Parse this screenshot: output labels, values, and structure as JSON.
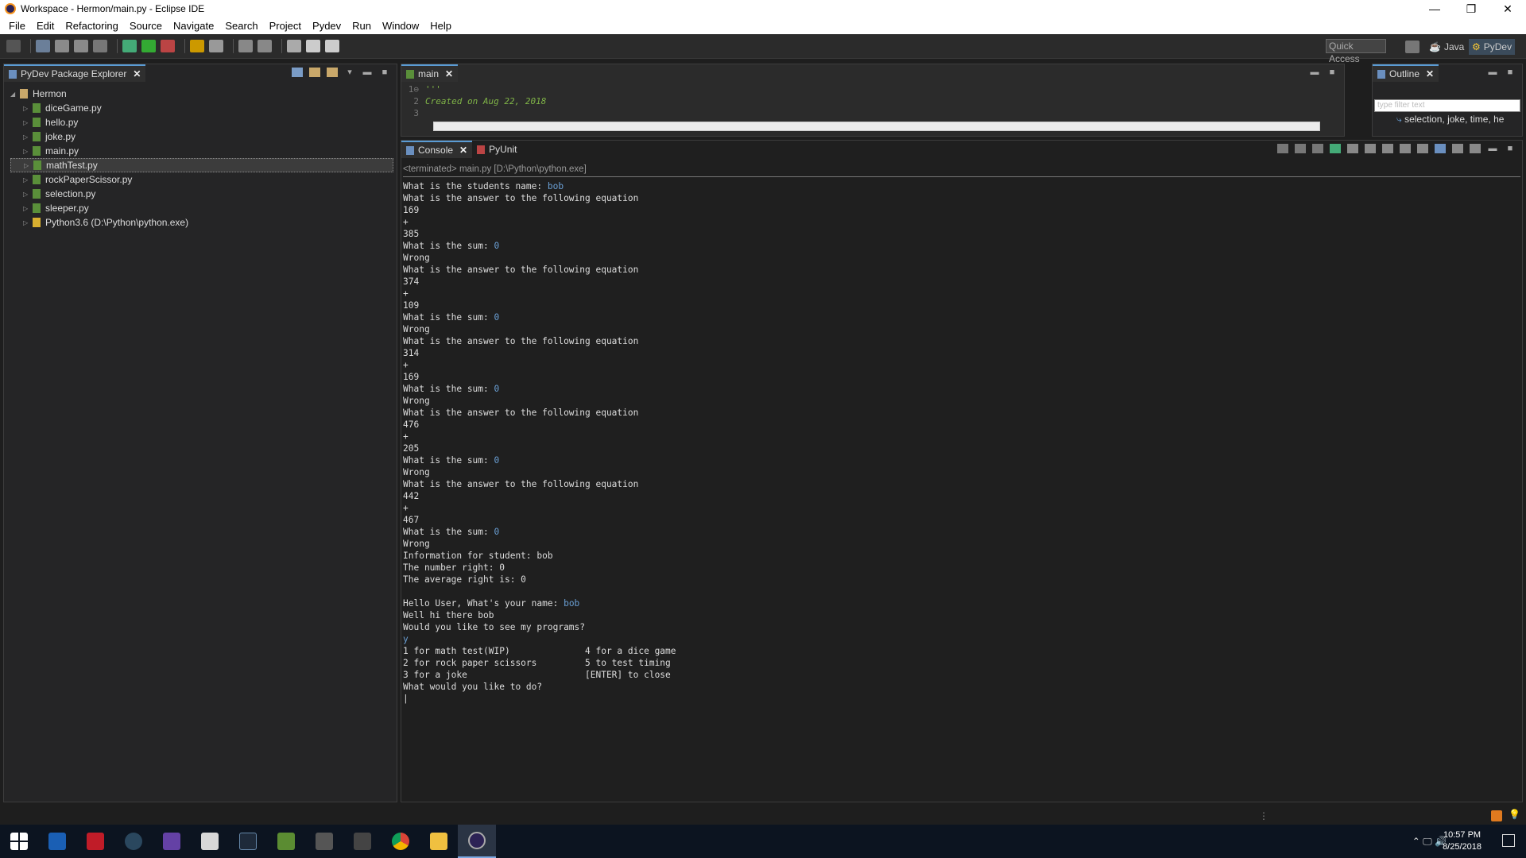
{
  "window": {
    "title": "Workspace - Hermon/main.py - Eclipse IDE",
    "controls": [
      "—",
      "❐",
      "✕"
    ]
  },
  "menu": [
    "File",
    "Edit",
    "Refactoring",
    "Source",
    "Navigate",
    "Search",
    "Project",
    "Pydev",
    "Run",
    "Window",
    "Help"
  ],
  "quick_access": "Quick Access",
  "perspectives": {
    "java": "Java",
    "pydev": "PyDev"
  },
  "explorer": {
    "tab_label": "PyDev Package Explorer",
    "project": "Hermon",
    "items": [
      {
        "label": "diceGame.py",
        "selected": false
      },
      {
        "label": "hello.py",
        "selected": false
      },
      {
        "label": "joke.py",
        "selected": false
      },
      {
        "label": "main.py",
        "selected": false
      },
      {
        "label": "mathTest.py",
        "selected": true
      },
      {
        "label": "rockPaperScissor.py",
        "selected": false
      },
      {
        "label": "selection.py",
        "selected": false
      },
      {
        "label": "sleeper.py",
        "selected": false
      },
      {
        "label": "Python3.6  (D:\\Python\\python.exe)",
        "selected": false
      }
    ]
  },
  "editor": {
    "tab_label": "main",
    "lines": [
      {
        "num": "1⊖",
        "text": "'''"
      },
      {
        "num": "2",
        "text": "Created on Aug 22, 2018"
      },
      {
        "num": "3",
        "text": ""
      }
    ]
  },
  "outline": {
    "tab_label": "Outline",
    "filter_placeholder": "type filter text",
    "item": "selection, joke, time, he"
  },
  "console": {
    "tab_label": "Console",
    "tab2_label": "PyUnit",
    "terminated": "<terminated> main.py [D:\\Python\\python.exe]",
    "lines": [
      {
        "text": "What is the students name: ",
        "input": "bob"
      },
      {
        "text": "What is the answer to the following equation",
        "input": ""
      },
      {
        "text": "169",
        "input": ""
      },
      {
        "text": "+",
        "input": ""
      },
      {
        "text": "385",
        "input": ""
      },
      {
        "text": "What is the sum: ",
        "input": "0"
      },
      {
        "text": "Wrong",
        "input": ""
      },
      {
        "text": "What is the answer to the following equation",
        "input": ""
      },
      {
        "text": "374",
        "input": ""
      },
      {
        "text": "+",
        "input": ""
      },
      {
        "text": "109",
        "input": ""
      },
      {
        "text": "What is the sum: ",
        "input": "0"
      },
      {
        "text": "Wrong",
        "input": ""
      },
      {
        "text": "What is the answer to the following equation",
        "input": ""
      },
      {
        "text": "314",
        "input": ""
      },
      {
        "text": "+",
        "input": ""
      },
      {
        "text": "169",
        "input": ""
      },
      {
        "text": "What is the sum: ",
        "input": "0"
      },
      {
        "text": "Wrong",
        "input": ""
      },
      {
        "text": "What is the answer to the following equation",
        "input": ""
      },
      {
        "text": "476",
        "input": ""
      },
      {
        "text": "+",
        "input": ""
      },
      {
        "text": "205",
        "input": ""
      },
      {
        "text": "What is the sum: ",
        "input": "0"
      },
      {
        "text": "Wrong",
        "input": ""
      },
      {
        "text": "What is the answer to the following equation",
        "input": ""
      },
      {
        "text": "442",
        "input": ""
      },
      {
        "text": "+",
        "input": ""
      },
      {
        "text": "467",
        "input": ""
      },
      {
        "text": "What is the sum: ",
        "input": "0"
      },
      {
        "text": "Wrong",
        "input": ""
      },
      {
        "text": "Information for student: bob",
        "input": ""
      },
      {
        "text": "The number right: 0",
        "input": ""
      },
      {
        "text": "The average right is: 0",
        "input": ""
      },
      {
        "text": "",
        "input": ""
      },
      {
        "text": "Hello User, What's your name: ",
        "input": "bob"
      },
      {
        "text": "Well hi there bob",
        "input": ""
      },
      {
        "text": "Would you like to see my programs?",
        "input": ""
      },
      {
        "text": "",
        "input": "y"
      },
      {
        "text": "1 for math test(WIP)              4 for a dice game",
        "input": ""
      },
      {
        "text": "2 for rock paper scissors         5 to test timing",
        "input": ""
      },
      {
        "text": "3 for a joke                      [ENTER] to close",
        "input": ""
      },
      {
        "text": "What would you like to do?",
        "input": ""
      },
      {
        "text": "|",
        "input": ""
      }
    ]
  },
  "taskbar": {
    "time": "10:57 PM",
    "date": "8/25/2018",
    "apps": [
      "start-icon",
      "app-icon",
      "app-icon",
      "steam-icon",
      "twitch-icon",
      "app-icon",
      "app-icon",
      "minecraft-icon",
      "game-icon",
      "game-icon",
      "chrome-icon",
      "folder-icon",
      "eclipse-icon"
    ]
  }
}
